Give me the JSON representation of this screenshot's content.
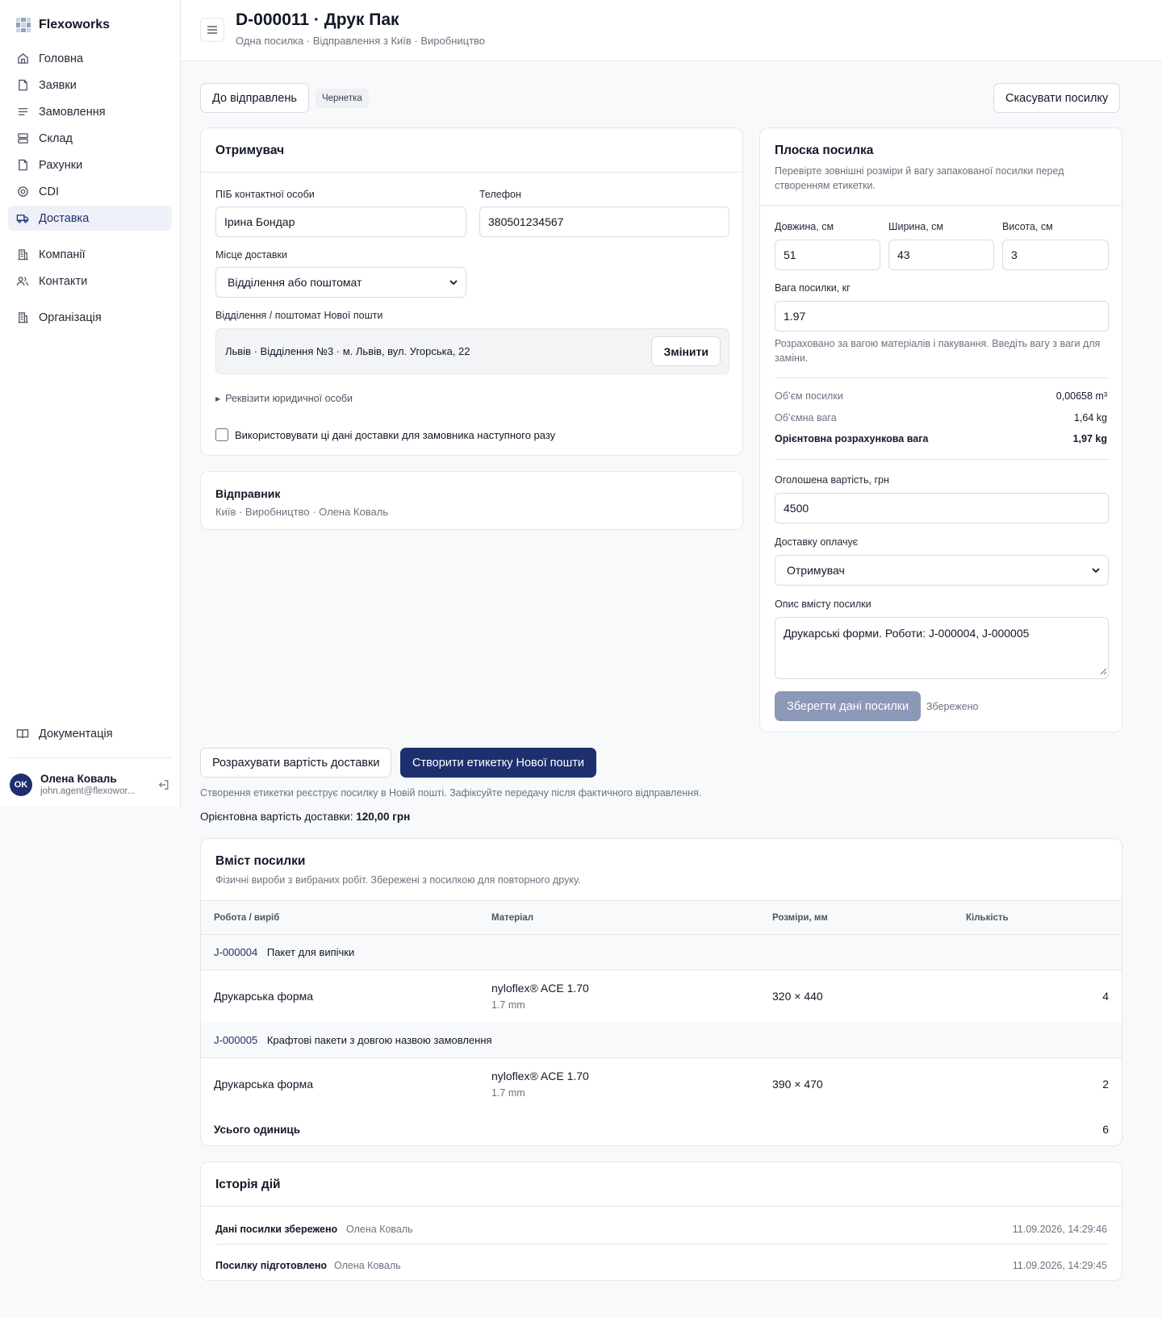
{
  "app": {
    "brand": "Flexoworks"
  },
  "sidebar": {
    "items": [
      {
        "label": "Головна",
        "icon": "home-icon"
      },
      {
        "label": "Заявки",
        "icon": "file-icon"
      },
      {
        "label": "Замовлення",
        "icon": "list-icon"
      },
      {
        "label": "Склад",
        "icon": "database-icon"
      },
      {
        "label": "Рахунки",
        "icon": "file-icon"
      },
      {
        "label": "CDI",
        "icon": "target-icon"
      },
      {
        "label": "Доставка",
        "icon": "truck-icon",
        "active": true
      },
      {
        "label": "Компанії",
        "icon": "building-icon"
      },
      {
        "label": "Контакти",
        "icon": "users-icon"
      },
      {
        "label": "Організація",
        "icon": "building-icon"
      }
    ],
    "docs_label": "Документація",
    "user": {
      "initials": "OK",
      "name": "Олена Коваль",
      "email": "john.agent@flexowor..."
    }
  },
  "header": {
    "title": "D-000011 · Друк Пак",
    "subtitle": "Одна посилка · Відправлення з Київ · Виробництво"
  },
  "toolbar": {
    "back_label": "До відправлень",
    "status_badge": "Чернетка",
    "cancel_label": "Скасувати посилку"
  },
  "recipient": {
    "title": "Отримувач",
    "name_label": "ПІБ контактної особи",
    "name_value": "Ірина Бондар",
    "phone_label": "Телефон",
    "phone_value": "380501234567",
    "place_label": "Місце доставки",
    "place_value": "Відділення або поштомат",
    "branch_label": "Відділення / поштомат Нової пошти",
    "branch_value": "Львів · Відділення №3 · м. Львів, вул. Угорська, 22",
    "change_label": "Змінити",
    "legal_label": "Реквізити юридичної особи",
    "save_checkbox_label": "Використовувати ці дані доставки для замовника наступного разу"
  },
  "sender": {
    "title": "Відправник",
    "details": "Київ · Виробництво · Олена Коваль"
  },
  "parcel": {
    "title": "Плоска посилка",
    "description": "Перевірте зовнішні розміри й вагу запакованої посилки перед створенням етикетки.",
    "length_label": "Довжина, см",
    "length_value": "51",
    "width_label": "Ширина, см",
    "width_value": "43",
    "height_label": "Висота, см",
    "height_value": "3",
    "weight_label": "Вага посилки, кг",
    "weight_value": "1.97",
    "weight_hint": "Розраховано за вагою матеріалів і пакування. Введіть вагу з ваги для заміни.",
    "volume_label": "Об’єм посилки",
    "volume_value": "0,00658 m³",
    "vol_weight_label": "Об’ємна вага",
    "vol_weight_value": "1,64 kg",
    "est_weight_label": "Орієнтовна розрахункова вага",
    "est_weight_value": "1,97 kg",
    "declared_label": "Оголошена вартість, грн",
    "declared_value": "4500",
    "payer_label": "Доставку оплачує",
    "payer_value": "Отримувач",
    "content_label": "Опис вмісту посилки",
    "content_value": "Друкарські форми. Роботи: J-000004, J-000005",
    "save_label": "Зберегти дані посилки",
    "saved_status": "Збережено"
  },
  "actions": {
    "calc_label": "Розрахувати вартість доставки",
    "create_label": "Створити етикетку Нової пошти",
    "note": "Створення етикетки реєструє посилку в Новій пошті. Зафіксуйте передачу після фактичного відправлення.",
    "cost_label": "Орієнтовна вартість доставки:",
    "cost_value": "120,00 грн"
  },
  "contents": {
    "title": "Вміст посилки",
    "subtitle": "Фізичні вироби з вибраних робіт. Збережені з посилкою для повторного друку.",
    "columns": [
      "Робота / виріб",
      "Матеріал",
      "Розміри, мм",
      "Кількість"
    ],
    "groups": [
      {
        "job": "J-000004",
        "name": "Пакет для випічки",
        "items": [
          {
            "product": "Друкарська форма",
            "material": "nyloflex® ACE 1.70",
            "thickness": "1.7 mm",
            "size": "320 × 440",
            "qty": "4"
          }
        ]
      },
      {
        "job": "J-000005",
        "name": "Крафтові пакети з довгою назвою замовлення",
        "items": [
          {
            "product": "Друкарська форма",
            "material": "nyloflex® ACE 1.70",
            "thickness": "1.7 mm",
            "size": "390 × 470",
            "qty": "2"
          }
        ]
      }
    ],
    "total_label": "Усього одиниць",
    "total_value": "6"
  },
  "history": {
    "title": "Історія дій",
    "entries": [
      {
        "action": "Дані посилки збережено",
        "user": "Олена Коваль",
        "time": "11.09.2026, 14:29:46"
      },
      {
        "action": "Посилку підготовлено",
        "user": "Олена Коваль",
        "time": "11.09.2026, 14:29:45"
      }
    ]
  }
}
